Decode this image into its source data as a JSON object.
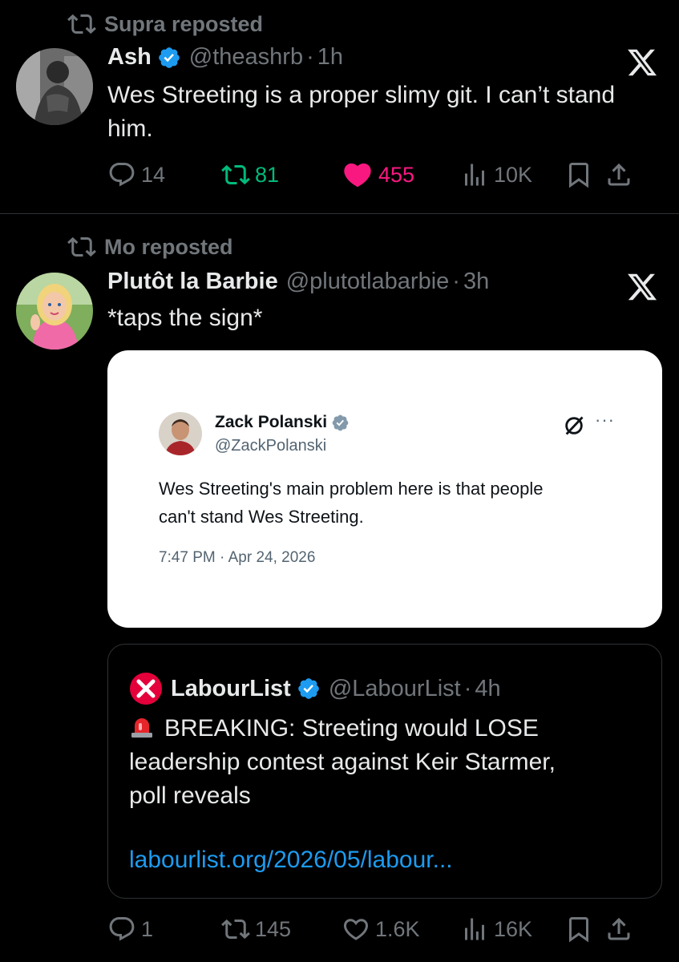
{
  "tweets": [
    {
      "reposted_by": "Supra reposted",
      "name": "Ash",
      "handle": "@theashrb",
      "sep": "·",
      "time": "1h",
      "text_line1": "Wes Streeting is a proper slimy git. I can’t stand",
      "text_line2": "him.",
      "replies": "14",
      "reposts": "81",
      "likes": "455",
      "views": "10K"
    },
    {
      "reposted_by": "Mo reposted",
      "name": "Plutôt la Barbie",
      "handle": "@plutotlabarbie",
      "sep": "·",
      "time": "3h",
      "text": "*taps the sign*",
      "embed": {
        "name": "Zack Polanski",
        "handle": "@ZackPolanski",
        "text_line1": "Wes Streeting's main problem here is that people",
        "text_line2": "can't stand Wes Streeting.",
        "timestamp": "7:47 PM · Apr 24, 2026",
        "more": "···"
      },
      "quote": {
        "name": "LabourList",
        "handle": "@LabourList",
        "sep": "·",
        "time": "4h",
        "text_line1": "BREAKING: Streeting would LOSE",
        "text_line2": "leadership contest against Keir Starmer,",
        "text_line3": "poll reveals",
        "link": "labourlist.org/2026/05/labour..."
      },
      "replies": "1",
      "reposts": "145",
      "likes": "1.6K",
      "views": "16K"
    }
  ],
  "colors": {
    "background": "#000000",
    "text": "#e7e9ea",
    "muted": "#71767b",
    "repost_green": "#00ba7c",
    "like_pink": "#f91880",
    "link_blue": "#1d9bf0",
    "verified_blue": "#1d9bf0"
  },
  "icons": [
    "repost-icon",
    "verified-icon",
    "x-logo-icon",
    "reply-icon",
    "like-icon",
    "views-icon",
    "bookmark-icon",
    "share-icon",
    "grok-icon",
    "siren-icon",
    "labourlist-logo-icon"
  ]
}
